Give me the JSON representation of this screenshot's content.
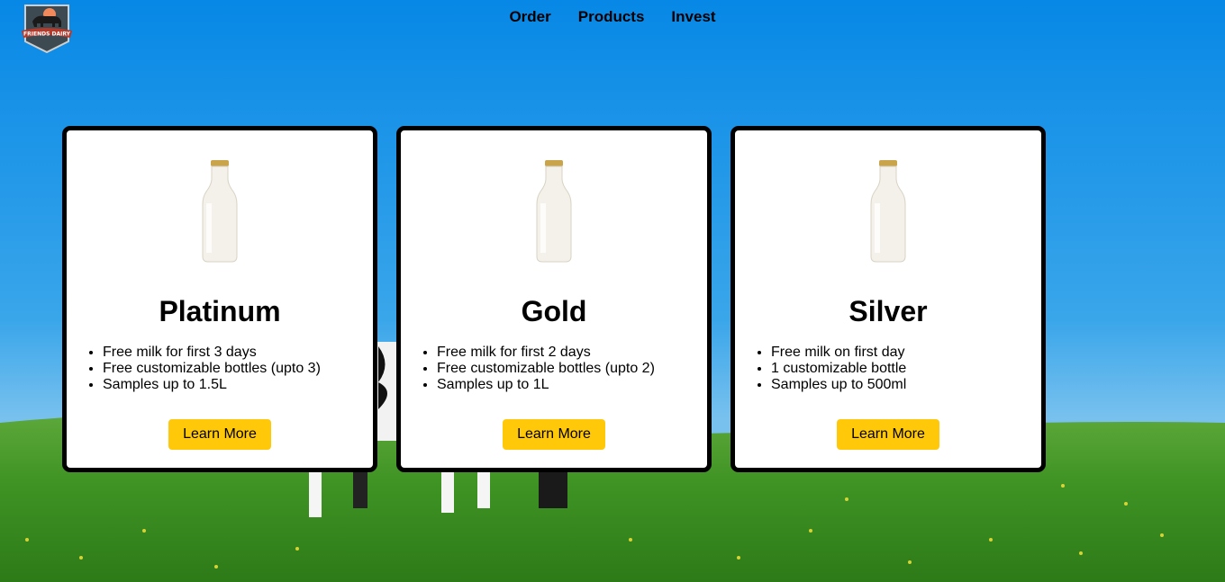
{
  "brand": {
    "logo_text": "FRIENDS DAIRY"
  },
  "nav": {
    "items": [
      {
        "label": "Order"
      },
      {
        "label": "Products"
      },
      {
        "label": "Invest"
      }
    ]
  },
  "plans": [
    {
      "title": "Platinum",
      "features": [
        "Free milk for first 3 days",
        "Free customizable bottles (upto 3)",
        "Samples up to 1.5L"
      ],
      "button": "Learn More"
    },
    {
      "title": "Gold",
      "features": [
        "Free milk for first 2 days",
        "Free customizable bottles (upto 2)",
        "Samples up to 1L"
      ],
      "button": "Learn More"
    },
    {
      "title": "Silver",
      "features": [
        "Free milk on first day",
        "1 customizable bottle",
        "Samples up to 500ml"
      ],
      "button": "Learn More"
    }
  ],
  "colors": {
    "sky": "#0a8ee4",
    "grass": "#3c8f1f",
    "button": "#ffc90a"
  }
}
